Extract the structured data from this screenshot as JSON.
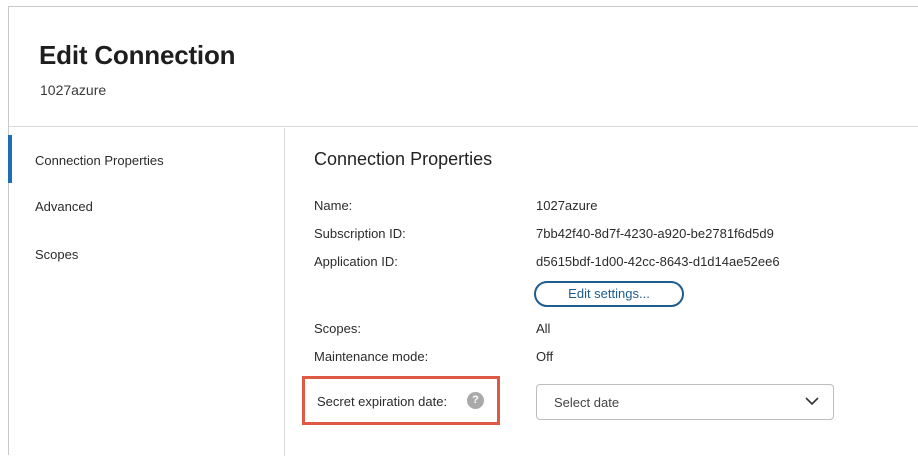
{
  "header": {
    "title": "Edit Connection",
    "subtitle": "1027azure"
  },
  "sidebar": {
    "items": [
      {
        "label": "Connection Properties",
        "active": true
      },
      {
        "label": "Advanced",
        "active": false
      },
      {
        "label": "Scopes",
        "active": false
      }
    ]
  },
  "main": {
    "section_title": "Connection Properties",
    "properties": [
      {
        "label": "Name:",
        "value": "1027azure"
      },
      {
        "label": "Subscription ID:",
        "value": "7bb42f40-8d7f-4230-a920-be2781f6d5d9"
      },
      {
        "label": "Application ID:",
        "value": "d5615bdf-1d00-42cc-8643-d1d14ae52ee6"
      },
      {
        "label": "Scopes:",
        "value": "All"
      },
      {
        "label": "Maintenance mode:",
        "value": "Off"
      }
    ],
    "edit_settings_label": "Edit settings...",
    "secret_expiration": {
      "label": "Secret expiration date:",
      "help_icon": "?",
      "placeholder": "Select date"
    }
  },
  "colors": {
    "accent": "#1c6fb2",
    "button_border": "#1e5d8f",
    "highlight": "#de5a45",
    "help_icon": "#a9a9a9"
  },
  "icons": {
    "help": "question-circle-icon",
    "dropdown": "chevron-down-icon"
  }
}
